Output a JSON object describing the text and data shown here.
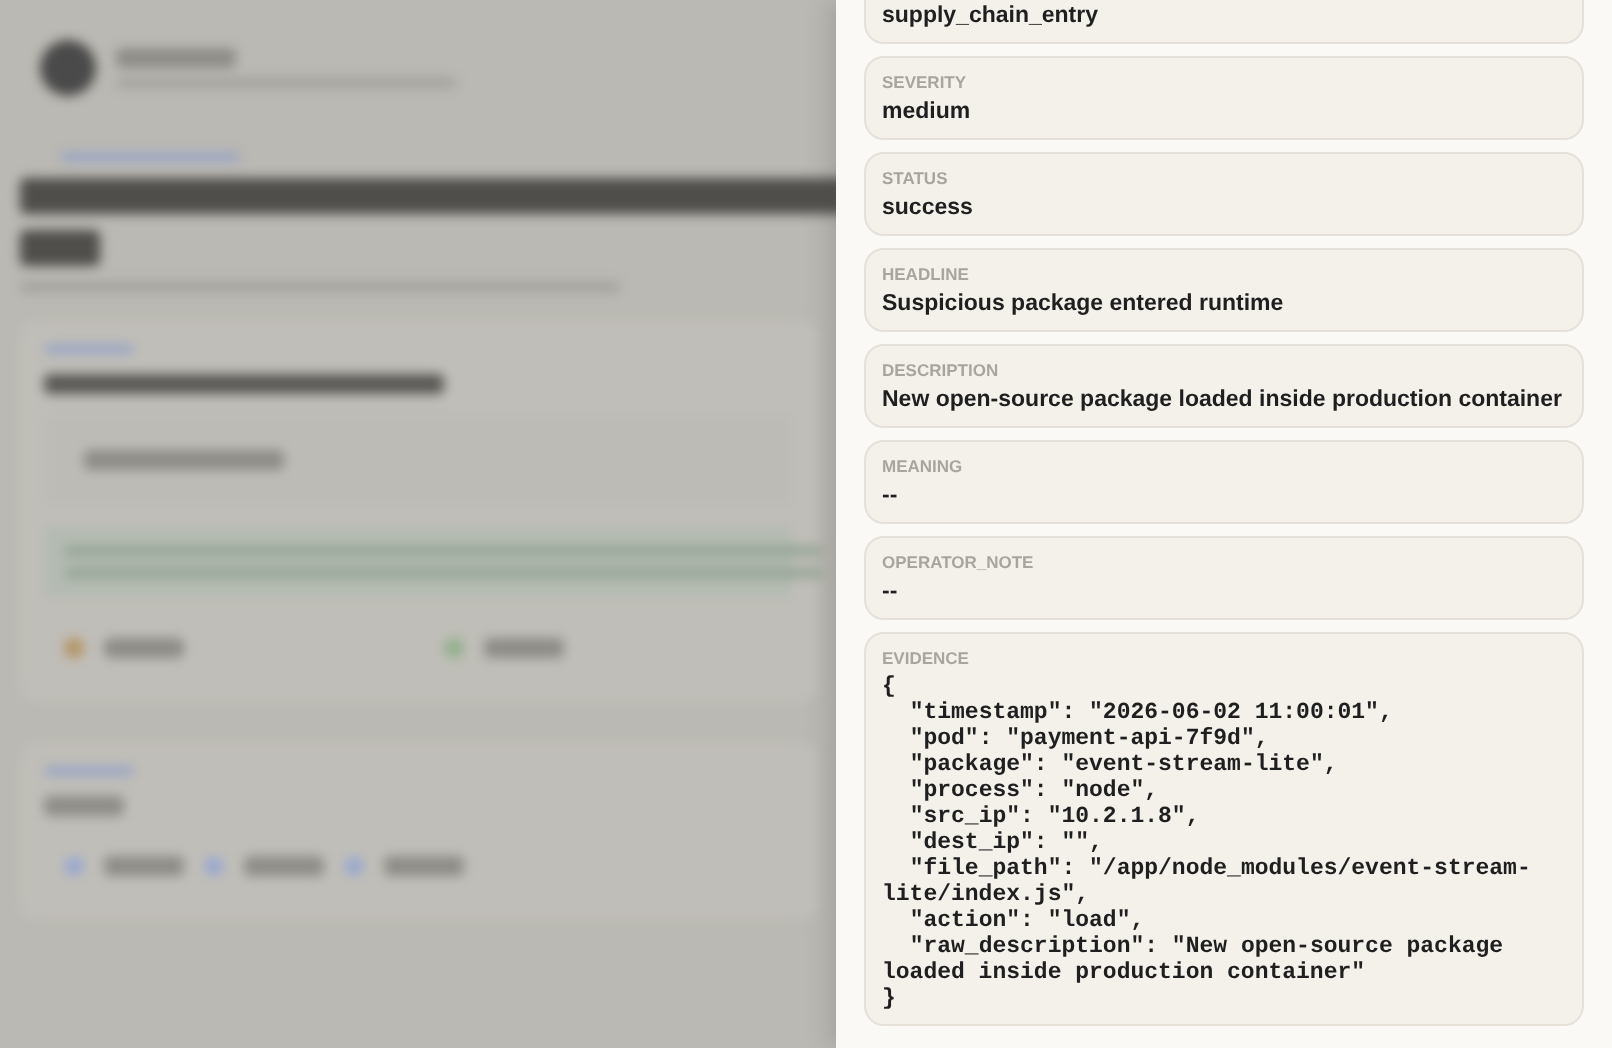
{
  "detail_panel": {
    "fields": [
      {
        "value": "supply_chain_entry"
      },
      {
        "label": "SEVERITY",
        "value": "medium"
      },
      {
        "label": "STATUS",
        "value": "success"
      },
      {
        "label": "HEADLINE",
        "value": "Suspicious package entered runtime"
      },
      {
        "label": "DESCRIPTION",
        "value": "New open-source package loaded inside production container"
      },
      {
        "label": "MEANING",
        "value": "--"
      },
      {
        "label": "OPERATOR_NOTE",
        "value": "--"
      }
    ],
    "evidence": {
      "label": "EVIDENCE",
      "text": "{\n  \"timestamp\": \"2026-06-02 11:00:01\",\n  \"pod\": \"payment-api-7f9d\",\n  \"package\": \"event-stream-lite\",\n  \"process\": \"node\",\n  \"src_ip\": \"10.2.1.8\",\n  \"dest_ip\": \"\",\n  \"file_path\": \"/app/node_modules/event-stream-lite/index.js\",\n  \"action\": \"load\",\n  \"raw_description\": \"New open-source package loaded inside production container\"\n}"
    }
  }
}
